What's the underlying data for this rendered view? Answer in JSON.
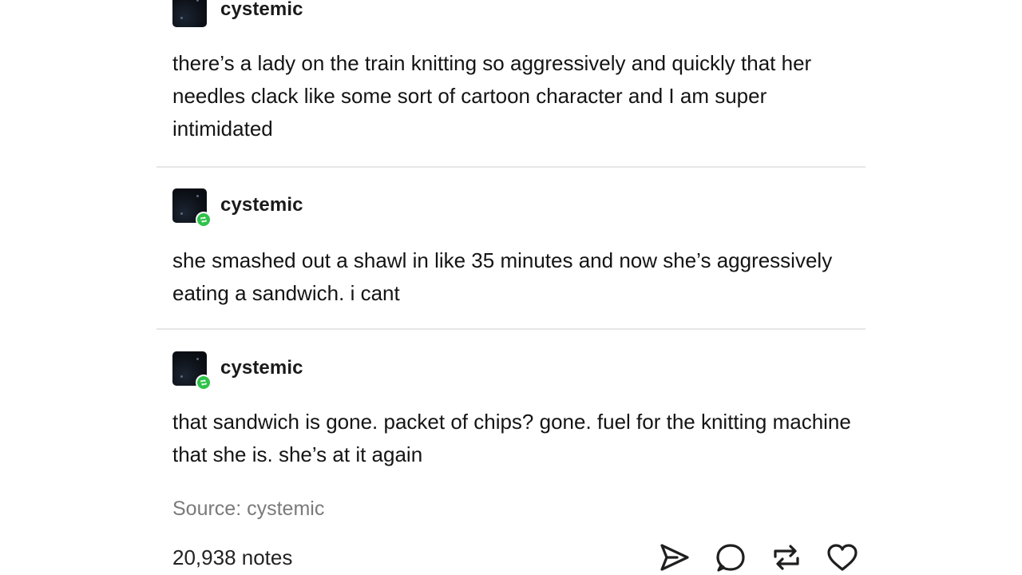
{
  "posts": [
    {
      "username": "cystemic",
      "reblog": false,
      "text": "there’s a lady on the train knitting so aggressively and quickly that her needles clack like some sort of cartoon character and I am super intimidated"
    },
    {
      "username": "cystemic",
      "reblog": true,
      "text": "she smashed out a shawl in like 35 minutes and now she’s aggressively eating a sandwich. i cant"
    },
    {
      "username": "cystemic",
      "reblog": true,
      "text": "that sandwich is gone. packet of chips? gone. fuel for the knitting machine that she is. she’s at it again"
    }
  ],
  "source": "Source: cystemic",
  "footer": {
    "notes": "20,938 notes",
    "actions": [
      "send-icon",
      "comment-icon",
      "reblog-icon",
      "heart-icon"
    ]
  },
  "colors": {
    "badge_green": "#2fc24a",
    "divider": "#e6e6e6",
    "source_gray": "#7a7a7a"
  }
}
